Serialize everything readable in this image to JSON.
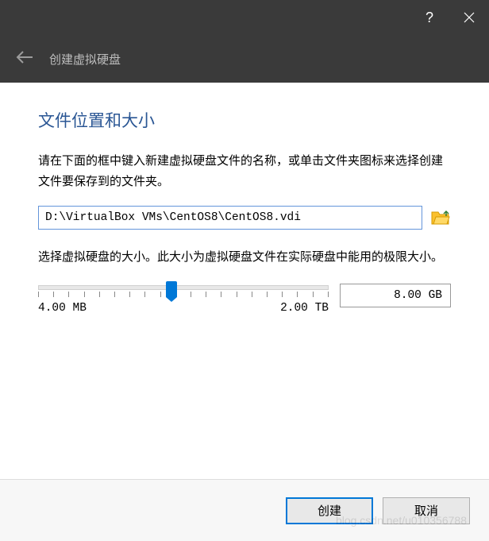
{
  "titlebar": {
    "help_icon": "?",
    "close_icon": "×"
  },
  "header": {
    "title": "创建虚拟硬盘"
  },
  "heading": "文件位置和大小",
  "description": "请在下面的框中键入新建虚拟硬盘文件的名称，或单击文件夹图标来选择创建文件要保存到的文件夹。",
  "path_value": "D:\\VirtualBox VMs\\CentOS8\\CentOS8.vdi",
  "size_desc": "选择虚拟硬盘的大小。此大小为虚拟硬盘文件在实际硬盘中能用的极限大小。",
  "slider": {
    "min_label": "4.00 MB",
    "max_label": "2.00 TB",
    "value_label": "8.00 GB"
  },
  "buttons": {
    "create": "创建",
    "cancel": "取消"
  },
  "watermark": "blog.csdn.net/u010356788"
}
